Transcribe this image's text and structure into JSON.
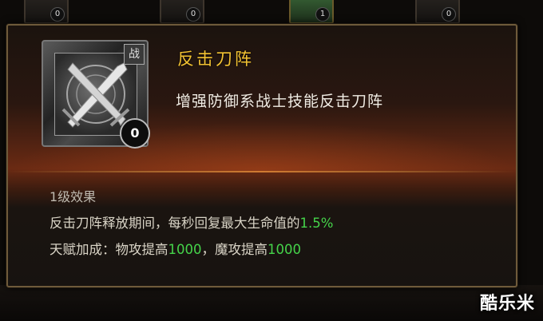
{
  "background": {
    "slot_counts": [
      "0",
      "0",
      "1",
      "0"
    ]
  },
  "tooltip": {
    "icon_badge": "战",
    "skill_level": "0",
    "skill_name": "反击刀阵",
    "skill_desc": "增强防御系战士技能反击刀阵",
    "level_effect_title": "1级效果",
    "effect_line1": {
      "text": "反击刀阵释放期间，每秒回复最大生命值的",
      "value": "1.5%"
    },
    "effect_line2": {
      "prefix": "天赋加成：物攻提高",
      "value1": "1000",
      "middle": "，魔攻提高",
      "value2": "1000"
    },
    "highlight_color": "#45d44a",
    "title_color": "#f2c232"
  },
  "watermark": "酷乐米"
}
